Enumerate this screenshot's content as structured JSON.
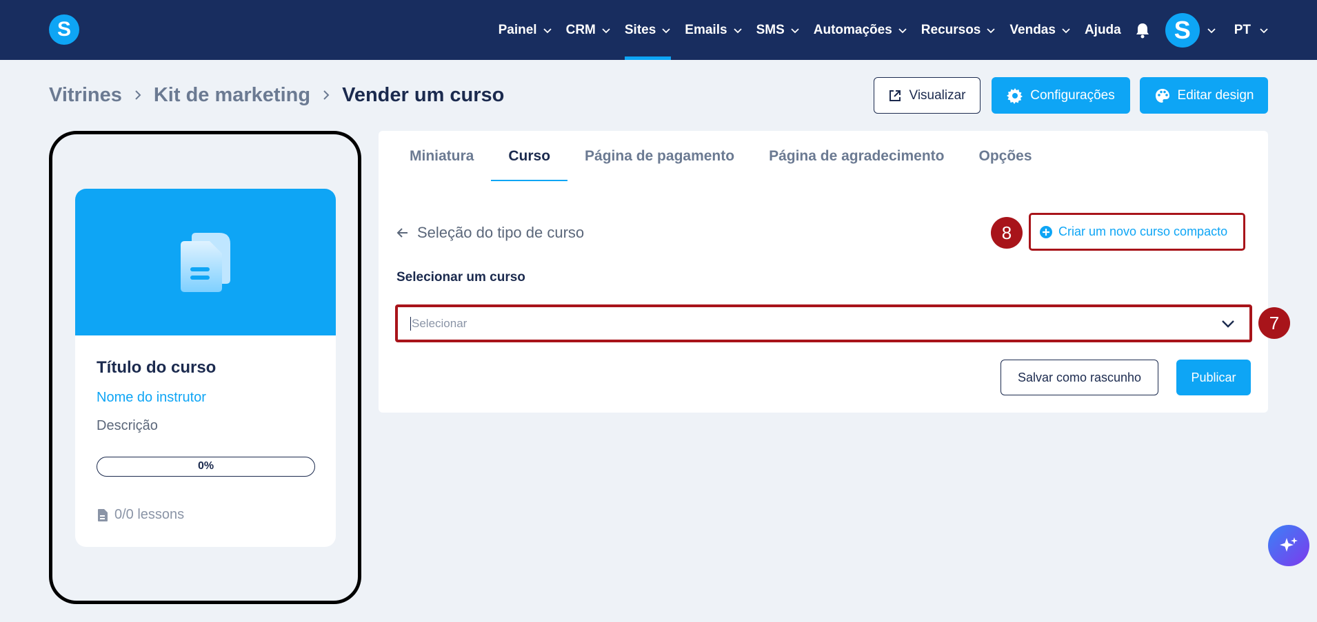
{
  "app": {
    "logo_letter": "S"
  },
  "nav": {
    "items": [
      {
        "label": "Painel",
        "has_dropdown": true,
        "active": false
      },
      {
        "label": "CRM",
        "has_dropdown": true,
        "active": false
      },
      {
        "label": "Sites",
        "has_dropdown": true,
        "active": true
      },
      {
        "label": "Emails",
        "has_dropdown": true,
        "active": false
      },
      {
        "label": "SMS",
        "has_dropdown": true,
        "active": false
      },
      {
        "label": "Automações",
        "has_dropdown": true,
        "active": false
      },
      {
        "label": "Recursos",
        "has_dropdown": true,
        "active": false
      },
      {
        "label": "Vendas",
        "has_dropdown": true,
        "active": false
      },
      {
        "label": "Ajuda",
        "has_dropdown": false,
        "active": false
      }
    ],
    "bell_icon": "bell-icon",
    "avatar_letter": "S",
    "language": "PT"
  },
  "breadcrumb": {
    "items": [
      "Vitrines",
      "Kit de marketing",
      "Vender um curso"
    ]
  },
  "actions": {
    "preview_label": "Visualizar",
    "settings_label": "Configurações",
    "edit_design_label": "Editar design"
  },
  "preview_card": {
    "title": "Título do curso",
    "instructor": "Nome do instrutor",
    "description": "Descrição",
    "progress_text": "0%",
    "progress_value": 0,
    "lessons": "0/0 lessons"
  },
  "tabs": [
    {
      "label": "Miniatura",
      "active": false
    },
    {
      "label": "Curso",
      "active": true
    },
    {
      "label": "Página de pagamento",
      "active": false
    },
    {
      "label": "Página de agradecimento",
      "active": false
    },
    {
      "label": "Opções",
      "active": false
    }
  ],
  "course_form": {
    "back_label": "Seleção do tipo de curso",
    "create_label": "Criar um novo curso compacto",
    "select_label": "Selecionar um curso",
    "select_placeholder": "Selecionar",
    "draft_label": "Salvar como rascunho",
    "publish_label": "Publicar"
  },
  "markers": {
    "create": "8",
    "select": "7"
  },
  "colors": {
    "navbar": "#182d5f",
    "accent": "#0ea5f5",
    "highlight": "#a8141a",
    "background": "#eef2f7"
  }
}
